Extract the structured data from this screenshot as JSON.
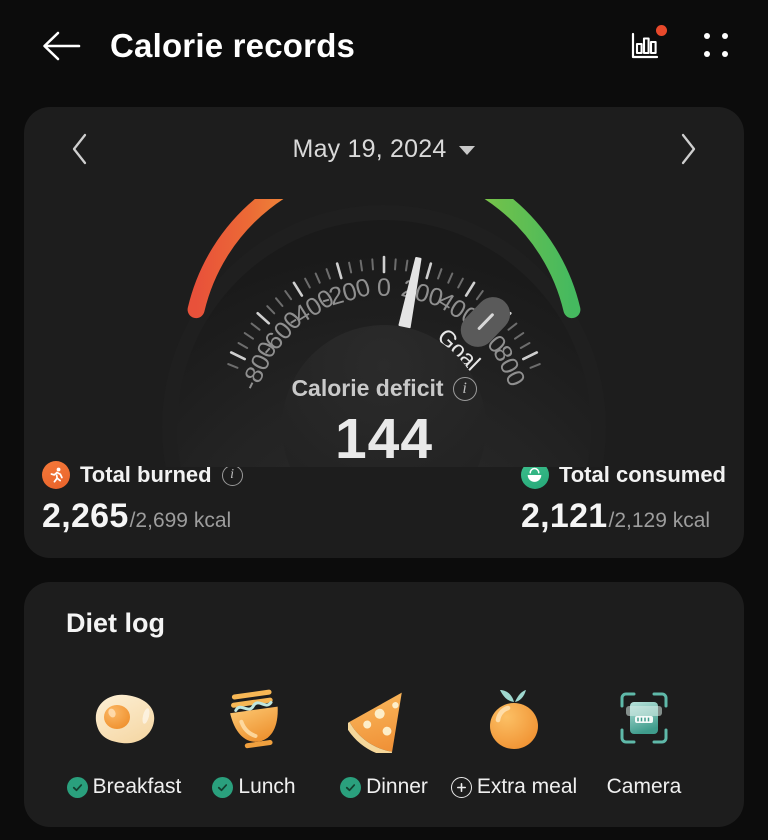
{
  "appbar": {
    "back_icon": "arrow-left-icon",
    "title": "Calorie records",
    "chart_icon": "bar-chart-icon",
    "has_notification_dot": true,
    "menu_icon": "grid-menu-icon"
  },
  "date_nav": {
    "prev_icon": "chevron-left-icon",
    "next_icon": "chevron-right-icon",
    "date": "May 19, 2024",
    "dropdown_icon": "chevron-down-icon"
  },
  "gauge": {
    "center_label": "Calorie deficit",
    "info_icon": "info-icon",
    "value": "144",
    "goal_label": "Goal"
  },
  "chart_data": {
    "type": "gauge",
    "title": "Calorie deficit",
    "value": 144,
    "goal": 550,
    "min": -900,
    "max": 900,
    "tick_labels": [
      "-800",
      "-600",
      "-400",
      "-200",
      "0",
      "200",
      "400",
      "600",
      "800"
    ],
    "tick_values": [
      -800,
      -600,
      -400,
      -200,
      0,
      200,
      400,
      600,
      800
    ],
    "minor_tick_step": 50,
    "arc_colors": [
      "#e8513a",
      "#ef7a37",
      "#f2b33c",
      "#efd645",
      "#bcd council",
      "#86c648",
      "#4cb94f"
    ],
    "gradient_stops": [
      "#e8513a",
      "#ee7a38",
      "#f3c041",
      "#ecdc4a",
      "#a8cf4b",
      "#57bd51",
      "#45b95f"
    ],
    "needle_color": "#e4e4e4",
    "units": "kcal"
  },
  "totals": [
    {
      "icon": "running-person-icon",
      "name": "Total burned",
      "has_info": true,
      "info_icon": "info-icon",
      "value": "2,265",
      "target": "/2,699 kcal",
      "accent": "#ea6a2c"
    },
    {
      "icon": "rice-bowl-icon",
      "name": "Total consumed",
      "has_info": false,
      "value": "2,121",
      "target": "/2,129 kcal",
      "accent": "#28a77a"
    }
  ],
  "diet_log": {
    "title": "Diet log",
    "meals": [
      {
        "label": "Breakfast",
        "icon": "fried-egg-icon",
        "status": "check"
      },
      {
        "label": "Lunch",
        "icon": "noodle-bowl-icon",
        "status": "check"
      },
      {
        "label": "Dinner",
        "icon": "pizza-slice-icon",
        "status": "check"
      },
      {
        "label": "Extra meal",
        "icon": "orange-fruit-icon",
        "status": "plus"
      },
      {
        "label": "Camera",
        "icon": "food-scan-icon",
        "status": "none"
      }
    ]
  },
  "colors": {
    "page_bg": "#0c0c0c",
    "card_bg": "#1d1d1d",
    "text_primary": "#f2f2f2",
    "text_secondary": "#9d9d9d",
    "check_green": "#2aa07d",
    "notify_red": "#e8492b"
  }
}
